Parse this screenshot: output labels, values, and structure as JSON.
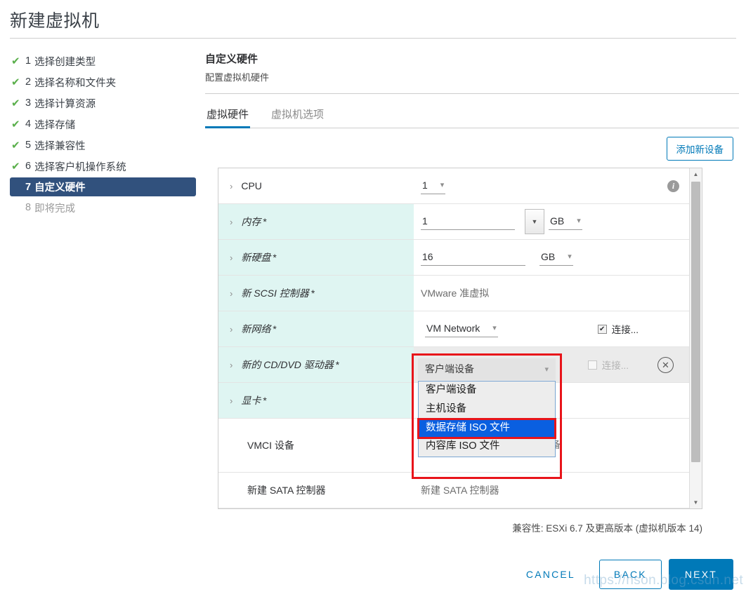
{
  "window": {
    "title": "新建虚拟机"
  },
  "sidebar": {
    "steps": [
      {
        "num": "1",
        "label": "选择创建类型",
        "state": "done"
      },
      {
        "num": "2",
        "label": "选择名称和文件夹",
        "state": "done"
      },
      {
        "num": "3",
        "label": "选择计算资源",
        "state": "done"
      },
      {
        "num": "4",
        "label": "选择存储",
        "state": "done"
      },
      {
        "num": "5",
        "label": "选择兼容性",
        "state": "done"
      },
      {
        "num": "6",
        "label": "选择客户机操作系统",
        "state": "done"
      },
      {
        "num": "7",
        "label": "自定义硬件",
        "state": "current"
      },
      {
        "num": "8",
        "label": "即将完成",
        "state": "pending"
      }
    ]
  },
  "pane": {
    "title": "自定义硬件",
    "subtitle": "配置虚拟机硬件"
  },
  "tabs": [
    {
      "label": "虚拟硬件",
      "active": true
    },
    {
      "label": "虚拟机选项",
      "active": false
    }
  ],
  "toolbar": {
    "add_device_label": "添加新设备"
  },
  "hardware": {
    "rows": {
      "cpu": {
        "label": "CPU",
        "value": "1",
        "caret": "›",
        "info_icon": "info-icon"
      },
      "memory": {
        "label": "内存",
        "required": "*",
        "value": "1",
        "unit": "GB"
      },
      "hard_disk": {
        "label": "新硬盘",
        "required": "*",
        "value": "16",
        "unit": "GB"
      },
      "scsi_controller": {
        "label": "新 SCSI 控制器",
        "required": "*",
        "value": "VMware 准虚拟"
      },
      "network": {
        "label": "新网络",
        "required": "*",
        "value": "VM Network",
        "connect_label": "连接...",
        "connect_checked": true
      },
      "cd_dvd": {
        "label": "新的 CD/DVD 驱动器",
        "required": "*",
        "value": "客户端设备",
        "connect_label": "连接...",
        "connect_checked": false,
        "remove_icon": "close-circle-icon"
      },
      "video_card": {
        "label": "显卡",
        "required": "*",
        "value": ""
      },
      "vmci": {
        "label": "VMCI 设备",
        "description": "支持的虚拟机 PCI 总线上的设备"
      },
      "sata_controller": {
        "label": "新建 SATA 控制器",
        "value": "新建 SATA 控制器"
      }
    }
  },
  "dropdown": {
    "trigger_value": "客户端设备",
    "options": [
      {
        "label": "客户端设备",
        "selected": false
      },
      {
        "label": "主机设备",
        "selected": false
      },
      {
        "label": "数据存储 ISO 文件",
        "selected": true
      },
      {
        "label": "内容库 ISO 文件",
        "selected": false
      }
    ],
    "highlight_color": "#e8141a",
    "selected_bg": "#0a5fe0"
  },
  "footer": {
    "compatibility": "兼容性: ESXi 6.7 及更高版本 (虚拟机版本 14)",
    "cancel_label": "CANCEL",
    "back_label": "BACK",
    "next_label": "NEXT"
  },
  "watermark": {
    "text": "https://hson.blog.csdn.net"
  }
}
